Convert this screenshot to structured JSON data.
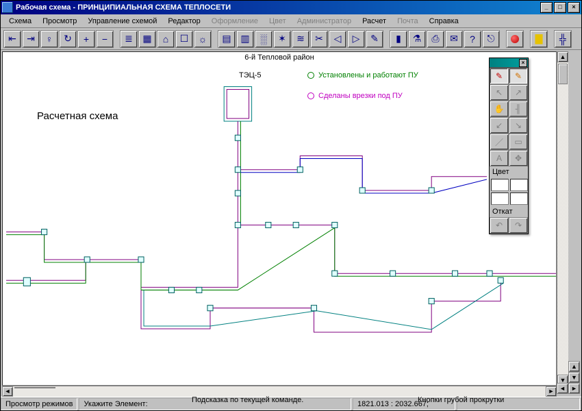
{
  "window": {
    "title": "Рабочая схема - ПРИНЦИПИАЛЬНАЯ СХЕМА ТЕПЛОСЕТИ",
    "sys": {
      "min": "_",
      "max": "□",
      "close": "×"
    }
  },
  "menu": {
    "items": [
      {
        "label": "Схема",
        "enabled": true
      },
      {
        "label": "Просмотр",
        "enabled": true
      },
      {
        "label": "Управление схемой",
        "enabled": true
      },
      {
        "label": "Редактор",
        "enabled": true
      },
      {
        "label": "Оформление",
        "enabled": false
      },
      {
        "label": "Цвет",
        "enabled": false
      },
      {
        "label": "Администратор",
        "enabled": false
      },
      {
        "label": "Расчет",
        "enabled": true
      },
      {
        "label": "Почта",
        "enabled": false
      },
      {
        "label": "Справка",
        "enabled": true
      }
    ]
  },
  "toolbar": {
    "groups": [
      [
        "nav-left",
        "nav-right",
        "nav-next",
        "refresh",
        "zoom-in",
        "zoom-out"
      ],
      [
        "notes",
        "table",
        "house",
        "new",
        "sun"
      ],
      [
        "paint",
        "brush",
        "spray",
        "spark",
        "zigzag",
        "scissors",
        "arrow-l",
        "arrow-r",
        "pipette"
      ],
      [
        "bars",
        "flask",
        "printer",
        "mail",
        "help",
        "exit"
      ],
      [
        "record"
      ],
      [
        "palette-yellow"
      ],
      [
        "network-tool"
      ]
    ]
  },
  "canvas": {
    "heading": "6-й Тепловой район",
    "station_label": "ТЭЦ-5",
    "overlay": "Расчетная схема",
    "legend": [
      {
        "color": "#008000",
        "text": "Установлены и работают ПУ"
      },
      {
        "color": "#c000c0",
        "text": "Сделаны врезки под ПУ"
      }
    ]
  },
  "palette": {
    "section_color": "Цвет",
    "section_undo": "Откат",
    "tools": [
      "edit-red",
      "edit-orange",
      "arrow-nw",
      "arrow-ne",
      "hand",
      "branch",
      "arrow-sw",
      "arrow-se",
      "line",
      "rect",
      "text-a",
      "move"
    ]
  },
  "status": {
    "mode": "Просмотр режимов",
    "prompt": "Укажите Элемент:",
    "coords": "1821.013 : 2032.667;"
  },
  "callouts": {
    "hint": "Подсказка по текущей команде.",
    "coarse": "Кнопки грубой прокрутки"
  }
}
